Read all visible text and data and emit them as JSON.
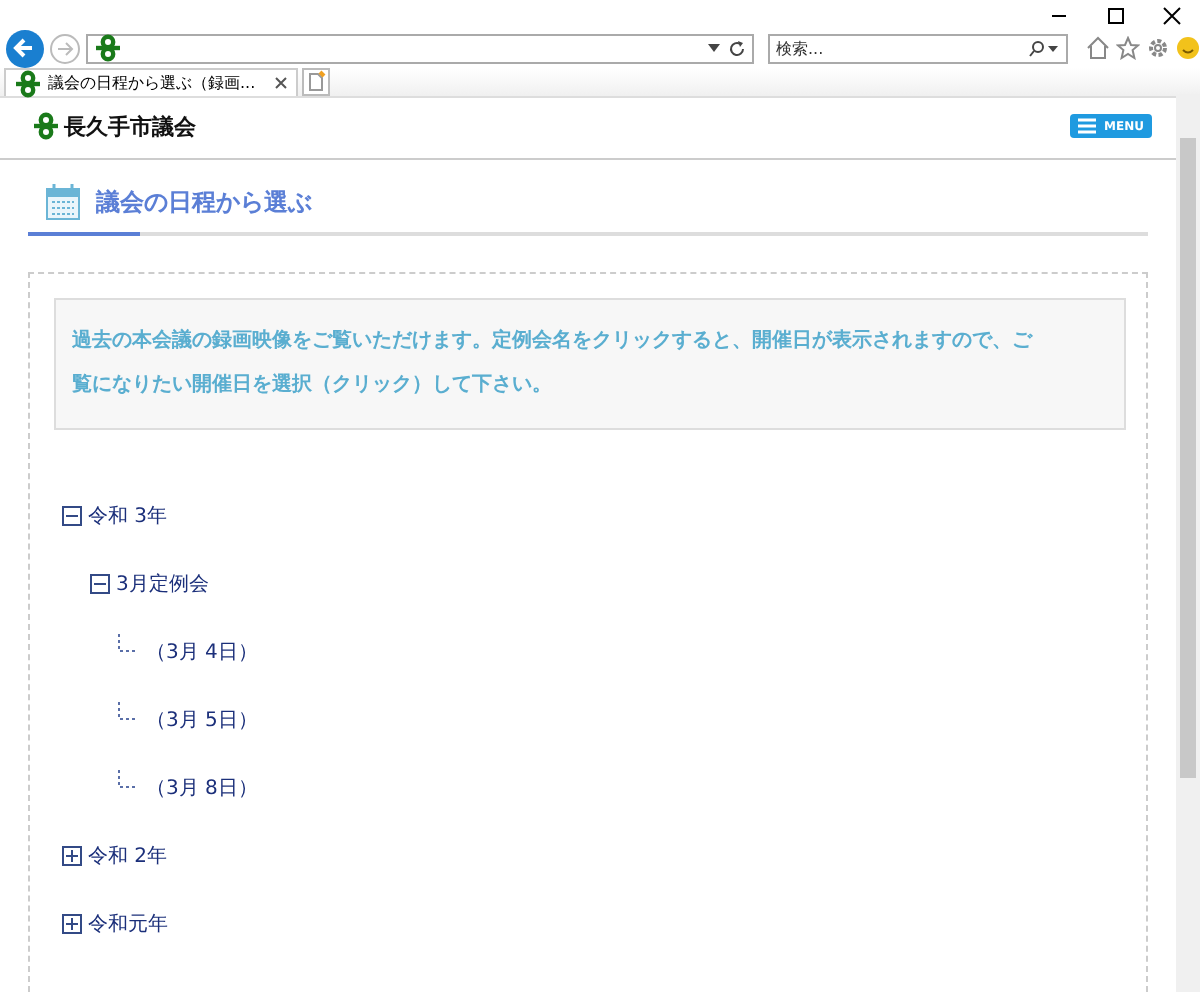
{
  "browser": {
    "search": {
      "placeholder": "検索..."
    },
    "tabs": [
      {
        "label": "議会の日程から選ぶ（録画...",
        "selected": true
      }
    ]
  },
  "site": {
    "logo": "長久手市議会",
    "menu": "MENU"
  },
  "heading": "議会の日程から選ぶ",
  "notice": "過去の本会議の録画映像をご覧いただけます。定例会名をクリックすると、開催日が表示されますので、ご覧になりたい開催日を選択（クリック）して下さい。",
  "tree": [
    {
      "label": "令和 3年",
      "expanded": true,
      "children": [
        {
          "label": "3月定例会",
          "expanded": true,
          "children": [
            {
              "label": "（3月 4日）"
            },
            {
              "label": "（3月 5日）"
            },
            {
              "label": "（3月 8日）"
            }
          ]
        }
      ]
    },
    {
      "label": "令和 2年",
      "expanded": false
    },
    {
      "label": "令和元年",
      "expanded": false
    }
  ]
}
